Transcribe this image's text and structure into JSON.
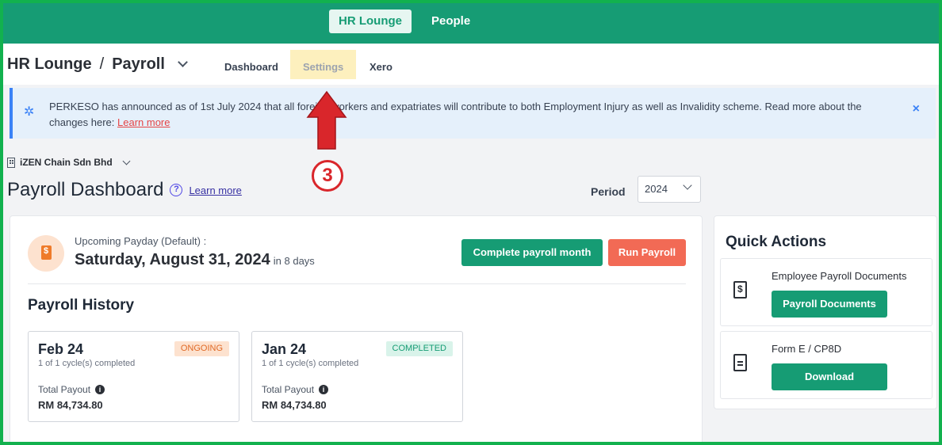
{
  "topbar": {
    "tabs": [
      {
        "label": "HR Lounge",
        "active": true
      },
      {
        "label": "People",
        "active": false
      }
    ]
  },
  "header": {
    "breadcrumb_root": "HR Lounge",
    "breadcrumb_sep": "/",
    "breadcrumb_current": "Payroll",
    "subtabs": [
      "Dashboard",
      "Settings",
      "Xero"
    ]
  },
  "banner": {
    "text": "PERKESO has announced as of 1st July 2024 that all foreign workers and expatriates will contribute to both Employment Injury as well as Invalidity scheme. Read more about the changes here: ",
    "link": "Learn more",
    "close": "×"
  },
  "company": {
    "name": "iZEN Chain Sdn Bhd"
  },
  "dashboard": {
    "title": "Payroll Dashboard",
    "help": "?",
    "learn_more": "Learn more",
    "period_label": "Period",
    "period_value": "2024"
  },
  "payday": {
    "label": "Upcoming Payday (Default) :",
    "date": "Saturday, August 31, 2024",
    "in_days": "in 8 days",
    "complete_button": "Complete payroll month",
    "run_button": "Run Payroll"
  },
  "history": {
    "title": "Payroll History",
    "total_label": "Total Payout",
    "cards": [
      {
        "month": "Feb 24",
        "cycles": "1 of 1 cycle(s) completed",
        "status": "ONGOING",
        "total": "RM 84,734.80"
      },
      {
        "month": "Jan 24",
        "cycles": "1 of 1 cycle(s) completed",
        "status": "COMPLETED",
        "total": "RM 84,734.80"
      }
    ]
  },
  "quick_actions": {
    "title": "Quick Actions",
    "items": [
      {
        "label": "Employee Payroll Documents",
        "button": "Payroll Documents",
        "icon": "file-dollar-icon"
      },
      {
        "label": "Form E / CP8D",
        "button": "Download",
        "icon": "file-text-icon"
      }
    ]
  },
  "annotation": {
    "step": "3"
  },
  "colors": {
    "brand": "#169c74",
    "run_payroll": "#f26a55",
    "highlight": "#fdf0be",
    "annotation": "#d9262b",
    "frame": "#12b14e"
  }
}
